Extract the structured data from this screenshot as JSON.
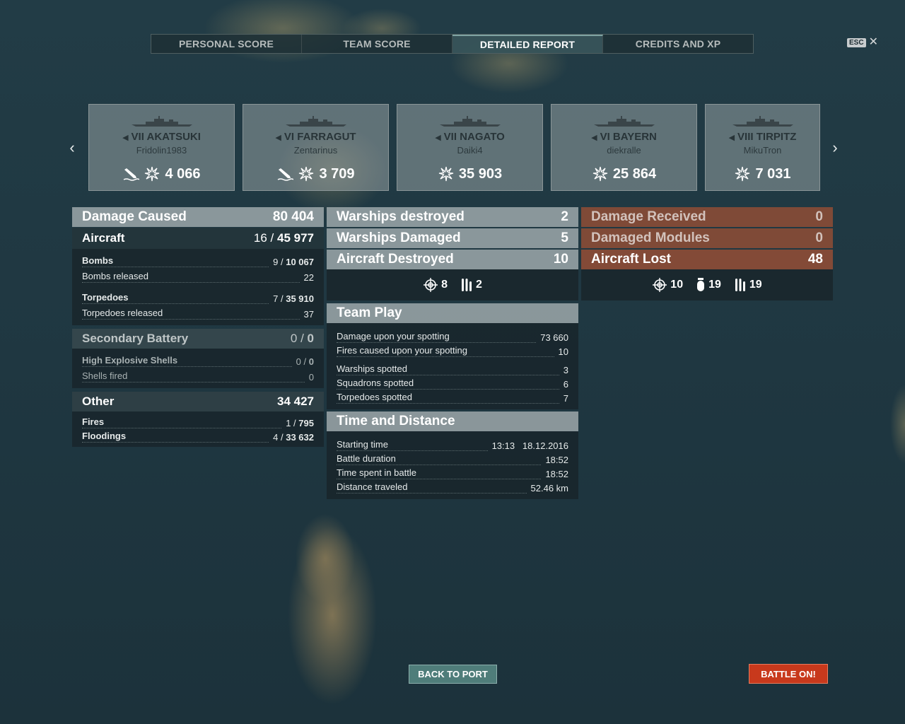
{
  "tabs": [
    {
      "label": "PERSONAL SCORE",
      "active": false
    },
    {
      "label": "TEAM SCORE",
      "active": false
    },
    {
      "label": "DETAILED REPORT",
      "active": true
    },
    {
      "label": "CREDITS AND XP",
      "active": false
    }
  ],
  "esc_label": "ESC",
  "close_glyph": "✕",
  "nav": {
    "prev_glyph": "‹",
    "next_glyph": "›"
  },
  "ships": [
    {
      "tier": "VII",
      "name": "AKATSUKI",
      "player": "Fridolin1983",
      "damage": "4 066",
      "sunk": true
    },
    {
      "tier": "VI",
      "name": "FARRAGUT",
      "player": "Zentarinus",
      "damage": "3 709",
      "sunk": true
    },
    {
      "tier": "VII",
      "name": "NAGATO",
      "player": "Daiki4",
      "damage": "35 903",
      "sunk": false
    },
    {
      "tier": "VI",
      "name": "BAYERN",
      "player": "diekralle",
      "damage": "25 864",
      "sunk": false
    },
    {
      "tier": "VIII",
      "name": "TIRPITZ",
      "player": "MikuTron",
      "damage": "7 031",
      "sunk": false
    }
  ],
  "damage_caused": {
    "label": "Damage Caused",
    "value": "80 404",
    "aircraft": {
      "label": "Aircraft",
      "hits": "16",
      "sep": "/",
      "damage": "45 977"
    },
    "bombs": {
      "label": "Bombs",
      "hits": "9",
      "sep": "/",
      "damage": "10 067"
    },
    "bombs_released": {
      "label": "Bombs released",
      "value": "22"
    },
    "torpedoes": {
      "label": "Torpedoes",
      "hits": "7",
      "sep": "/",
      "damage": "35 910"
    },
    "torpedoes_released": {
      "label": "Torpedoes released",
      "value": "37"
    },
    "secondary": {
      "label": "Secondary Battery",
      "hits": "0",
      "sep": "/",
      "damage": "0"
    },
    "he_shells": {
      "label": "High Explosive Shells",
      "hits": "0",
      "sep": "/",
      "damage": "0"
    },
    "shells_fired": {
      "label": "Shells fired",
      "value": "0"
    },
    "other": {
      "label": "Other",
      "value": "34 427"
    },
    "fires": {
      "label": "Fires",
      "hits": "1",
      "sep": "/",
      "damage": "795"
    },
    "floodings": {
      "label": "Floodings",
      "hits": "4",
      "sep": "/",
      "damage": "33 632"
    }
  },
  "warships": {
    "destroyed": {
      "label": "Warships destroyed",
      "value": "2"
    },
    "damaged": {
      "label": "Warships Damaged",
      "value": "5"
    },
    "aircraft_destroyed": {
      "label": "Aircraft Destroyed",
      "value": "10"
    },
    "icon_stats": [
      {
        "icon": "crosshair-icon",
        "value": "8"
      },
      {
        "icon": "torpedo-icon",
        "value": "2"
      }
    ]
  },
  "team_play": {
    "label": "Team Play",
    "rows": [
      {
        "label": "Damage upon your spotting",
        "value": "73 660"
      },
      {
        "label": "Fires caused upon your spotting",
        "value": "10"
      },
      {
        "label": "Warships spotted",
        "value": "3"
      },
      {
        "label": "Squadrons spotted",
        "value": "6"
      },
      {
        "label": "Torpedoes spotted",
        "value": "7"
      }
    ]
  },
  "time_distance": {
    "label": "Time and Distance",
    "rows": [
      {
        "label": "Starting time",
        "value": "13:13   18.12.2016"
      },
      {
        "label": "Battle duration",
        "value": "18:52"
      },
      {
        "label": "Time spent in battle",
        "value": "18:52"
      },
      {
        "label": "Distance traveled",
        "value": "52.46 km"
      }
    ]
  },
  "received": {
    "damage_received": {
      "label": "Damage Received",
      "value": "0"
    },
    "damaged_modules": {
      "label": "Damaged Modules",
      "value": "0"
    },
    "aircraft_lost": {
      "label": "Aircraft Lost",
      "value": "48"
    },
    "icon_stats": [
      {
        "icon": "crosshair-icon",
        "value": "10"
      },
      {
        "icon": "bomb-icon",
        "value": "19"
      },
      {
        "icon": "torpedo-icon",
        "value": "19"
      }
    ]
  },
  "buttons": {
    "back_to_port": "BACK TO PORT",
    "battle_on": "BATTLE ON!"
  }
}
